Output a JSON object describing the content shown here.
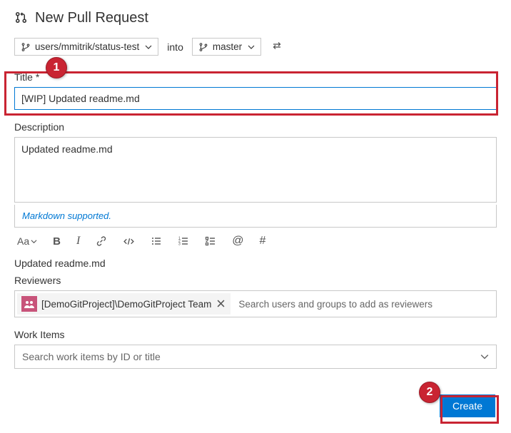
{
  "header": {
    "title": "New Pull Request"
  },
  "branches": {
    "source": "users/mmitrik/status-test",
    "into": "into",
    "target": "master"
  },
  "title_field": {
    "label": "Title",
    "value": "[WIP] Updated readme.md"
  },
  "description_field": {
    "label": "Description",
    "value": "Updated readme.md",
    "markdown_note": "Markdown supported."
  },
  "toolbar": {
    "font_size": "Aa",
    "bold": "B",
    "italic": "I",
    "at": "@",
    "hash": "#"
  },
  "preview": {
    "text": "Updated readme.md"
  },
  "reviewers": {
    "label": "Reviewers",
    "chip": "[DemoGitProject]\\DemoGitProject Team",
    "placeholder": "Search users and groups to add as reviewers"
  },
  "work_items": {
    "label": "Work Items",
    "placeholder": "Search work items by ID or title"
  },
  "create": {
    "label": "Create"
  },
  "annotations": {
    "one": "1",
    "two": "2"
  }
}
